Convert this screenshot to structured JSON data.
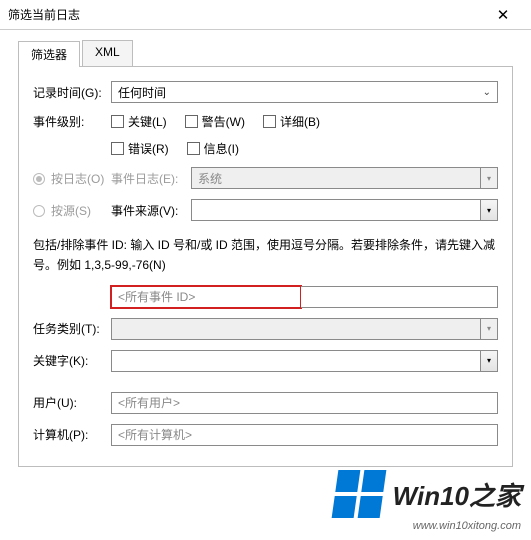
{
  "window": {
    "title": "筛选当前日志"
  },
  "tabs": {
    "filter": "筛选器",
    "xml": "XML"
  },
  "fields": {
    "logged": {
      "label": "记录时间(G):",
      "value": "任何时间"
    },
    "level": {
      "label": "事件级别:",
      "cb1": "关键(L)",
      "cb2": "警告(W)",
      "cb3": "详细(B)",
      "cb4": "错误(R)",
      "cb5": "信息(I)"
    },
    "radio1": "按日志(O)",
    "radio2": "按源(S)",
    "eventlog": {
      "label": "事件日志(E):",
      "value": "系统"
    },
    "eventsrc": {
      "label": "事件来源(V):",
      "value": ""
    },
    "help": "包括/排除事件 ID: 输入 ID 号和/或 ID 范围，使用逗号分隔。若要排除条件，请先键入减号。例如 1,3,5-99,-76(N)",
    "eventid": {
      "placeholder": "<所有事件 ID>"
    },
    "taskcat": {
      "label": "任务类别(T):",
      "value": ""
    },
    "keywords": {
      "label": "关键字(K):",
      "value": ""
    },
    "user": {
      "label": "用户(U):",
      "value": "<所有用户>"
    },
    "computer": {
      "label": "计算机(P):",
      "value": "<所有计算机>"
    }
  },
  "watermark": {
    "brand": "Win10之家",
    "url": "www.win10xitong.com"
  }
}
